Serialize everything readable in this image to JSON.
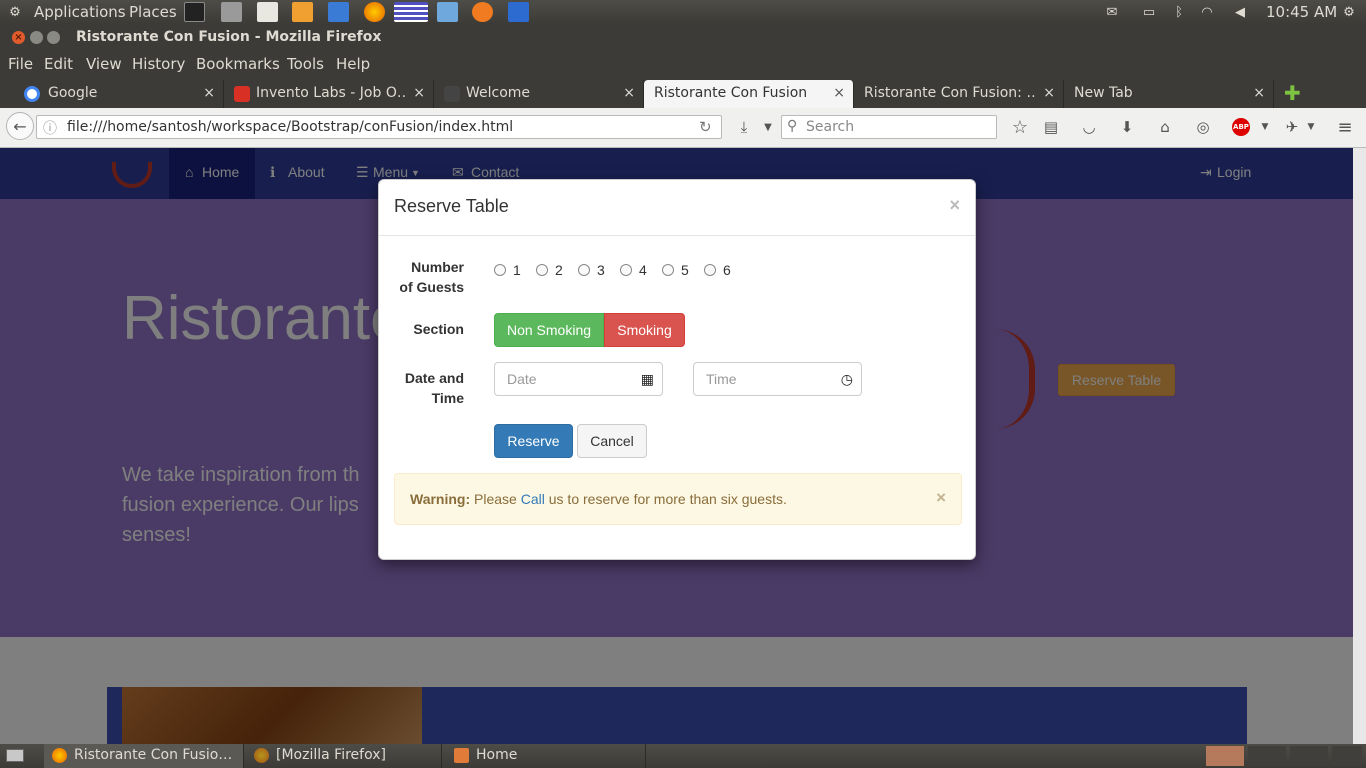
{
  "top_panel": {
    "applications": "Applications",
    "places": "Places",
    "clock": "10:45 AM"
  },
  "window": {
    "title": "Ristorante Con Fusion - Mozilla Firefox"
  },
  "menu": {
    "file": "File",
    "edit": "Edit",
    "view": "View",
    "history": "History",
    "bookmarks": "Bookmarks",
    "tools": "Tools",
    "help": "Help"
  },
  "tabs": [
    {
      "label": "Google"
    },
    {
      "label": "Invento Labs - Job O…"
    },
    {
      "label": "Welcome"
    },
    {
      "label": "Ristorante Con Fusion"
    },
    {
      "label": "Ristorante Con Fusion: …"
    },
    {
      "label": "New Tab"
    }
  ],
  "nav": {
    "url": "file:///home/santosh/workspace/Bootstrap/conFusion/index.html",
    "search_placeholder": "Search"
  },
  "site": {
    "nav_home": "Home",
    "nav_about": "About",
    "nav_menu": "Menu",
    "nav_contact": "Contact",
    "nav_login": "Login",
    "headline": "Ristorante",
    "tagline_line1": "We take inspiration from th",
    "tagline_line2": "fusion experience. Our lips",
    "tagline_line3": "senses!",
    "reserve_button": "Reserve Table"
  },
  "modal": {
    "title": "Reserve Table",
    "close": "×",
    "guests_label_1": "Number",
    "guests_label_2": "of Guests",
    "guest_options": [
      "1",
      "2",
      "3",
      "4",
      "5",
      "6"
    ],
    "section_label": "Section",
    "non_smoking": "Non Smoking",
    "smoking": "Smoking",
    "datetime_label_1": "Date and",
    "datetime_label_2": "Time",
    "date_placeholder": "Date",
    "time_placeholder": "Time",
    "reserve": "Reserve",
    "cancel": "Cancel",
    "warning_strong": "Warning:",
    "warning_pre": "Please",
    "warning_link": "Call",
    "warning_post": "us to reserve for more than six guests."
  },
  "taskbar": {
    "item1": "Ristorante Con Fusio…",
    "item2": "[Mozilla Firefox]",
    "item3": "Home"
  },
  "colors": {
    "site_nav": "#303f9f",
    "jumbotron": "#9575cd",
    "success": "#4cae4c",
    "danger": "#d9534f",
    "primary": "#337ab7"
  }
}
